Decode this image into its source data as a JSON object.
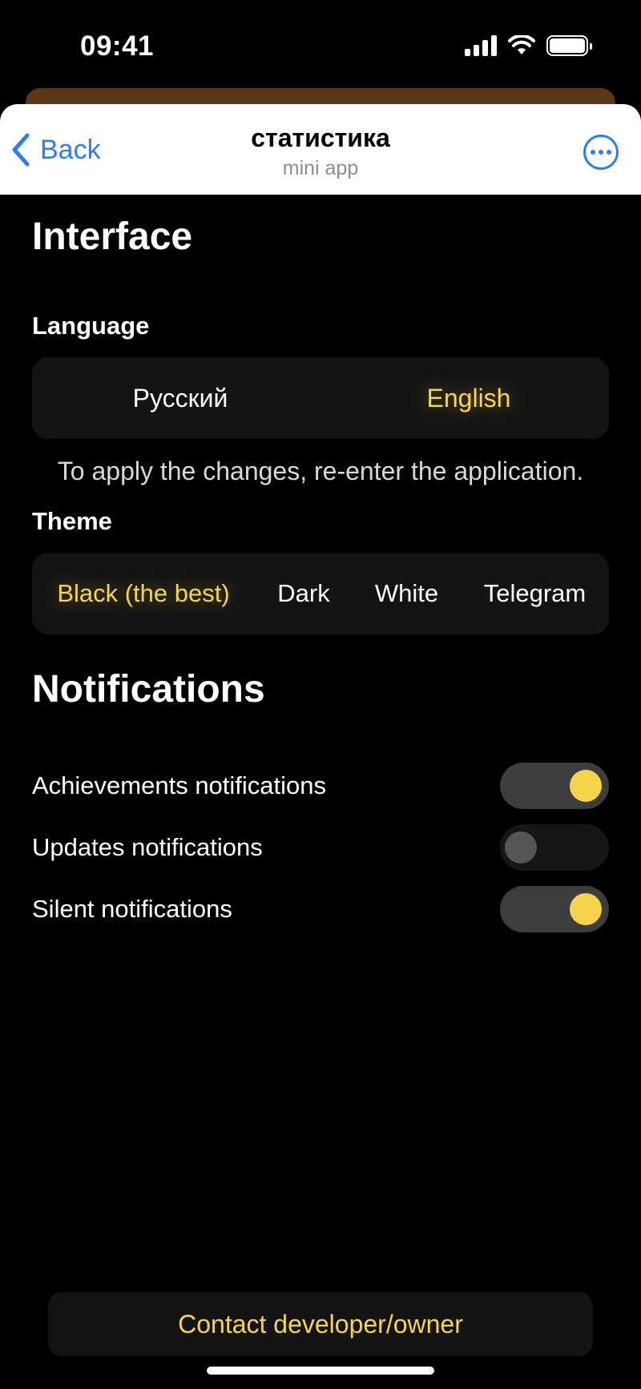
{
  "status_bar": {
    "time": "09:41"
  },
  "header": {
    "back_label": "Back",
    "title": "статистика",
    "subtitle": "mini app"
  },
  "interface": {
    "title": "Interface",
    "language_label": "Language",
    "languages": [
      {
        "label": "Русский",
        "active": false
      },
      {
        "label": "English",
        "active": true
      }
    ],
    "note": "To apply the changes, re-enter the application.",
    "theme_label": "Theme",
    "themes": [
      {
        "label": "Black (the best)",
        "active": true
      },
      {
        "label": "Dark",
        "active": false
      },
      {
        "label": "White",
        "active": false
      },
      {
        "label": "Telegram",
        "active": false
      }
    ]
  },
  "notifications": {
    "title": "Notifications",
    "items": [
      {
        "label": "Achievements notifications",
        "enabled": true
      },
      {
        "label": "Updates notifications",
        "enabled": false
      },
      {
        "label": "Silent notifications",
        "enabled": true
      }
    ]
  },
  "contact_button": "Contact developer/owner",
  "colors": {
    "accent": "#f7d54a",
    "link": "#2c7cf6",
    "strip": "#5b3717"
  }
}
